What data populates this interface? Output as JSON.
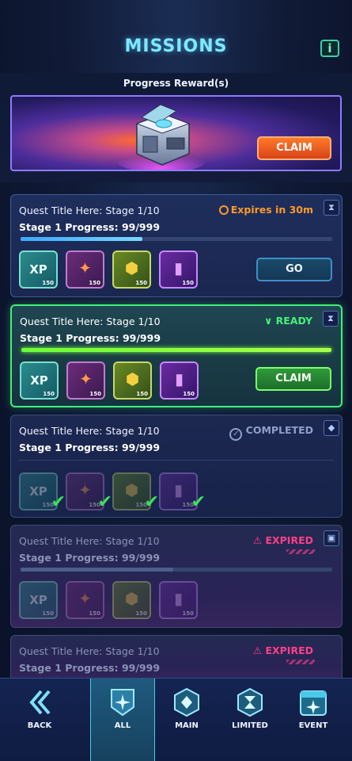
{
  "header": {
    "title": "MISSIONS",
    "info_label": "i"
  },
  "progress_reward": {
    "label": "Progress Reward(s)",
    "claim_label": "CLAIM"
  },
  "missions": [
    {
      "quest_title": "Quest Title Here: Stage 1/10",
      "progress_text": "Stage 1 Progress: 99/999",
      "status_text": "Expires in 30m",
      "progress_fraction": 0.39,
      "rewards": [
        {
          "type": "xp",
          "glyph": "XP",
          "qty": "150"
        },
        {
          "type": "star",
          "glyph": "✦",
          "qty": "150"
        },
        {
          "type": "chip",
          "glyph": "⬢",
          "qty": "150"
        },
        {
          "type": "cell",
          "glyph": "▮",
          "qty": "150"
        }
      ],
      "action_label": "GO"
    },
    {
      "quest_title": "Quest Title Here: Stage 1/10",
      "progress_text": "Stage 1 Progress: 99/999",
      "status_text": "READY",
      "progress_fraction": 1.0,
      "rewards": [
        {
          "type": "xp",
          "glyph": "XP",
          "qty": "150"
        },
        {
          "type": "star",
          "glyph": "✦",
          "qty": "150"
        },
        {
          "type": "chip",
          "glyph": "⬢",
          "qty": "150"
        },
        {
          "type": "cell",
          "glyph": "▮",
          "qty": "150"
        }
      ],
      "action_label": "CLAIM"
    },
    {
      "quest_title": "Quest Title Here: Stage 1/10",
      "progress_text": "Stage 1 Progress: 99/999",
      "status_text": "COMPLETED",
      "rewards": [
        {
          "type": "xp",
          "glyph": "XP",
          "qty": "150"
        },
        {
          "type": "star",
          "glyph": "✦",
          "qty": "150"
        },
        {
          "type": "chip",
          "glyph": "⬢",
          "qty": "150"
        },
        {
          "type": "cell",
          "glyph": "▮",
          "qty": "150"
        }
      ]
    },
    {
      "quest_title": "Quest Title Here: Stage 1/10",
      "progress_text": "Stage 1 Progress: 99/999",
      "status_text": "EXPIRED",
      "progress_fraction": 0.49,
      "rewards": [
        {
          "type": "xp",
          "glyph": "XP",
          "qty": "150"
        },
        {
          "type": "star",
          "glyph": "✦",
          "qty": "150"
        },
        {
          "type": "chip",
          "glyph": "⬢",
          "qty": "150"
        },
        {
          "type": "cell",
          "glyph": "▮",
          "qty": "150"
        }
      ]
    },
    {
      "quest_title": "Quest Title Here: Stage 1/10",
      "progress_text": "Stage 1 Progress: 99/999",
      "status_text": "EXPIRED"
    }
  ],
  "nav": {
    "back": "BACK",
    "all": "ALL",
    "main": "MAIN",
    "limited": "LIMITED",
    "event": "EVENT"
  },
  "colors": {
    "accent_cyan": "#7fe8ff",
    "ready_green": "#46f07a",
    "expires_orange": "#ff9a2a",
    "expired_pink": "#ff3f8a",
    "claim_orange": "#ff7a2a"
  }
}
